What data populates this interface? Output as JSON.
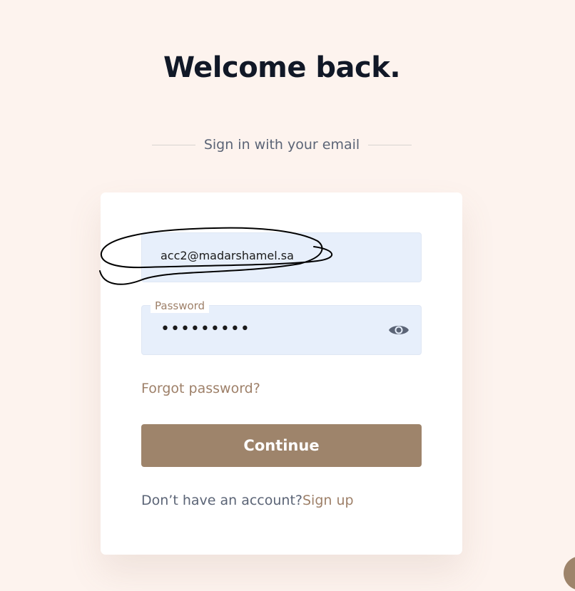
{
  "page": {
    "title": "Welcome back.",
    "subtitle": "Sign in with your email"
  },
  "form": {
    "email": {
      "value": "acc2@madarshamel.sa"
    },
    "password": {
      "label": "Password",
      "masked_value": "•••••••••",
      "toggle_icon": "eye-icon"
    },
    "forgot_label": "Forgot password?",
    "submit_label": "Continue",
    "signup_prompt": "Don’t have an account?",
    "signup_link": "Sign up"
  },
  "colors": {
    "background": "#fdf3ee",
    "accent": "#9e846b",
    "link": "#9e8069",
    "field_bg": "#e7effb",
    "heading": "#111827",
    "muted_text": "#5b6476"
  }
}
